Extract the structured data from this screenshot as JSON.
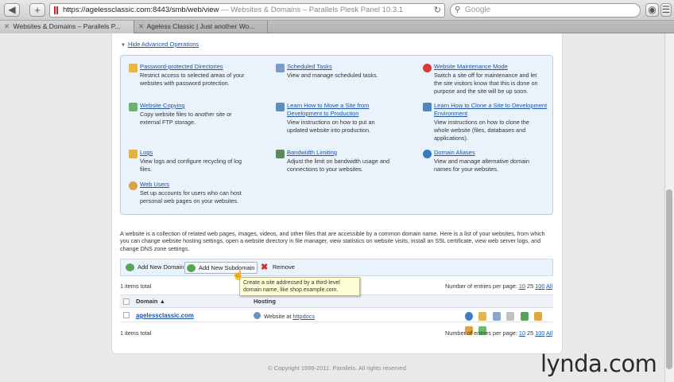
{
  "browser": {
    "url_main": "https://agelessclassic.com:8443/smb/web/view",
    "url_title": "Websites & Domains – Parallels Plesk Panel 10.3.1",
    "search_placeholder": "Google",
    "tabs": [
      {
        "label": "Websites & Domains – Parallels P..."
      },
      {
        "label": "Ageless Classic | Just another Wo..."
      }
    ]
  },
  "advanced": {
    "toggle_label": "Hide Advanced Operations",
    "operations": [
      {
        "title": "Password-protected Directories",
        "desc": [
          "Restrict access to selected areas of your",
          "websites with password protection."
        ],
        "icon": "folder-lock-icon"
      },
      {
        "title": "Scheduled Tasks",
        "desc": [
          "View and manage scheduled tasks."
        ],
        "icon": "calendar-icon"
      },
      {
        "title": "Website Maintenance Mode",
        "desc": [
          "Switch a site off for maintenance and let",
          "the site visitors know that this is done on",
          "purpose and the site will be up soon."
        ],
        "icon": "no-entry-icon"
      },
      {
        "title": "Website Copying",
        "desc": [
          "Copy website files to another site or",
          "external FTP storage."
        ],
        "icon": "copy-icon"
      },
      {
        "title": "Learn How to Move a Site from",
        "title2": "Development to Production",
        "desc": [
          "View instructions on how to put an",
          "updated website into production."
        ],
        "icon": "move-site-icon"
      },
      {
        "title": "Learn How to Clone a Site to Development",
        "title2": "Environment",
        "desc": [
          "View instructions on how to clone the",
          "whole website (files, databases and",
          "applications)."
        ],
        "icon": "clone-site-icon"
      },
      {
        "title": "Logs",
        "desc": [
          "View logs and configure recycling of log",
          "files."
        ],
        "icon": "logs-icon"
      },
      {
        "title": "Bandwidth Limiting",
        "desc": [
          "Adjust the limit on bandwidth usage and",
          "connections to your websites."
        ],
        "icon": "bandwidth-icon"
      },
      {
        "title": "Domain Aliases",
        "desc": [
          "View and manage alternative domain",
          "names for your websites."
        ],
        "icon": "domain-alias-icon"
      },
      {
        "title": "Web Users",
        "desc": [
          "Set up accounts for users who can host",
          "personal web pages on your websites."
        ],
        "icon": "web-users-icon"
      }
    ]
  },
  "description": [
    "A website is a collection of related web pages, images, videos, and other files that are accessible by a common domain name. Here is a list of your websites, from which",
    "you can change website hosting settings, open a website directory in file manager, view statistics on website visits, install an SSL certificate, view web server logs, and",
    "change DNS zone settings."
  ],
  "actions": {
    "add_domain": "Add New Domain",
    "add_subdomain": "Add New Subdomain",
    "remove": "Remove"
  },
  "tooltip": [
    "Create a site addressed by a third-level",
    "domain name, like shop.example.com."
  ],
  "list": {
    "items_total": "1 items total",
    "entries_label": "Number of entries per page:",
    "page_sizes": [
      "10",
      "25",
      "100",
      "All"
    ],
    "col_domain": "Domain ▲",
    "col_hosting": "Hosting",
    "rows": [
      {
        "domain": "agelessclassic.com",
        "hosting_prefix": "Website at",
        "hosting_link": "httpdocs"
      }
    ]
  },
  "footer": "© Copyright 1999-2011. Parallels. All rights reserved",
  "watermark": "lynda.com",
  "colors": {
    "link": "#1a55a8",
    "panel_bg": "#eaf2fb"
  }
}
